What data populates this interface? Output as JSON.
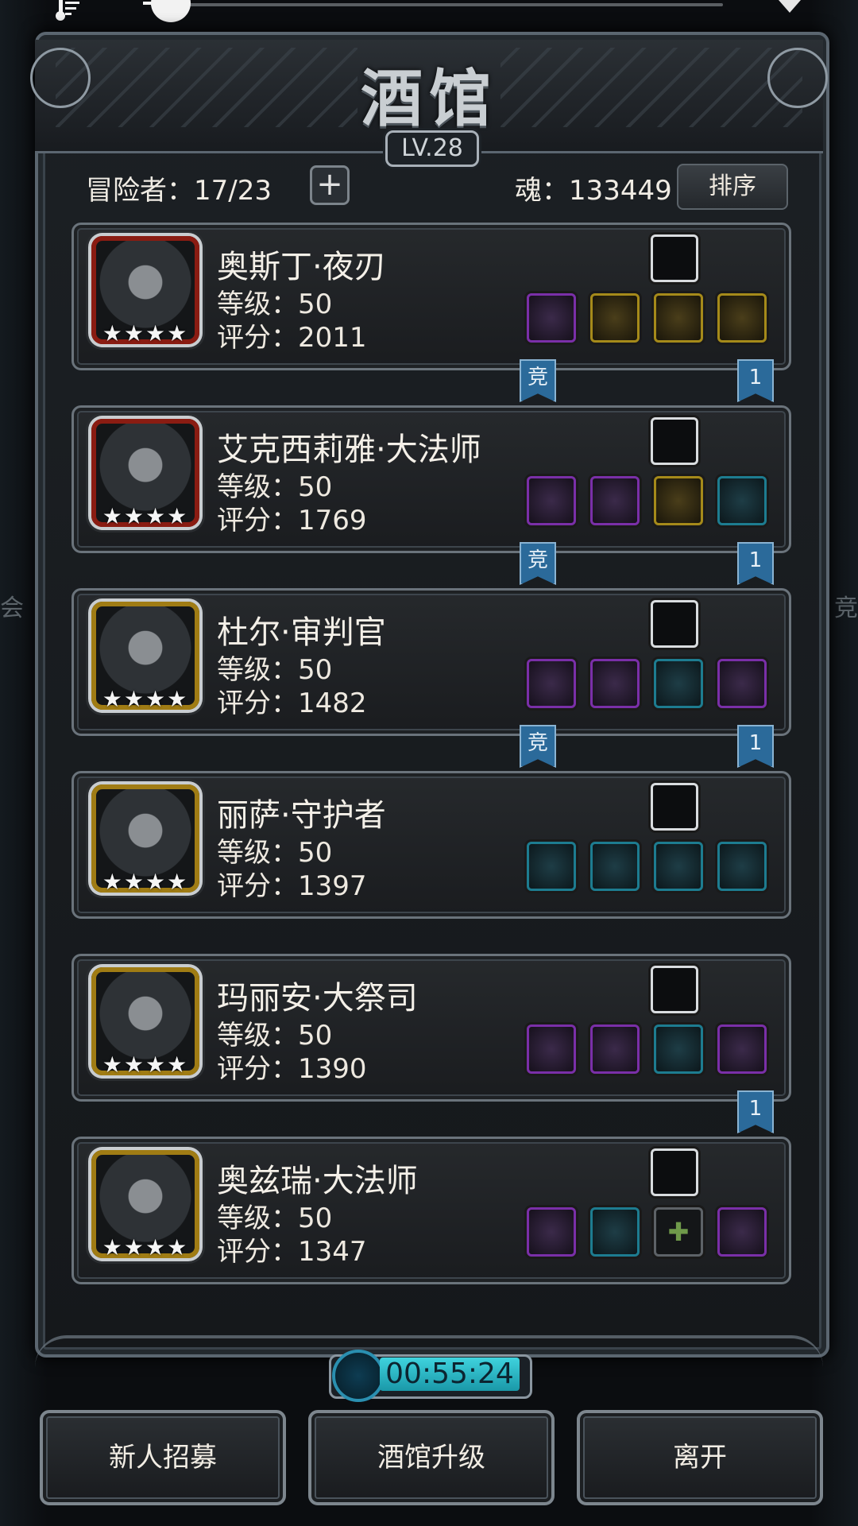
{
  "window": {
    "title": "酒馆",
    "level": "LV.28"
  },
  "stats": {
    "adventurers": "冒险者：17/23",
    "add_symbol": "+",
    "soul": "魂：133449",
    "sort_label": "排序"
  },
  "heroes": [
    {
      "name": "奥斯丁·夜刃",
      "level": "等级：50",
      "score": "评分：2011",
      "stars": "★★★★",
      "frame": "red",
      "slots": [
        "purple",
        "gold",
        "gold",
        "gold"
      ],
      "badge_left": "竞",
      "badge_right": "1"
    },
    {
      "name": "艾克西莉雅·大法师",
      "level": "等级：50",
      "score": "评分：1769",
      "stars": "★★★★",
      "frame": "red",
      "slots": [
        "purple",
        "purple",
        "gold",
        "teal"
      ],
      "badge_left": "竞",
      "badge_right": "1"
    },
    {
      "name": "杜尔·审判官",
      "level": "等级：50",
      "score": "评分：1482",
      "stars": "★★★★",
      "frame": "gold",
      "slots": [
        "purple",
        "purple",
        "teal",
        "purple"
      ],
      "badge_left": "竞",
      "badge_right": "1"
    },
    {
      "name": "丽萨·守护者",
      "level": "等级：50",
      "score": "评分：1397",
      "stars": "★★★★",
      "frame": "gold",
      "slots": [
        "teal",
        "teal",
        "teal",
        "teal"
      ],
      "badge_left": "",
      "badge_right": ""
    },
    {
      "name": "玛丽安·大祭司",
      "level": "等级：50",
      "score": "评分：1390",
      "stars": "★★★★",
      "frame": "gold",
      "slots": [
        "purple",
        "purple",
        "teal",
        "purple"
      ],
      "badge_left": "",
      "badge_right": "1"
    },
    {
      "name": "奥兹瑞·大法师",
      "level": "等级：50",
      "score": "评分：1347",
      "stars": "★★★★",
      "frame": "gold",
      "slots": [
        "purple",
        "teal",
        "empty",
        "purple"
      ],
      "badge_left": "",
      "badge_right": ""
    }
  ],
  "empty_slot_symbol": "✚",
  "timer": "00:55:24",
  "buttons": {
    "recruit": "新人招募",
    "upgrade": "酒馆升级",
    "leave": "离开"
  },
  "side_text": {
    "left": "会",
    "right": "竞"
  },
  "colors": {
    "accent_purple": "#7a2fa8",
    "accent_gold": "#a58a1a",
    "accent_teal": "#1d7c90",
    "ribbon_blue": "#2b6a9a",
    "timer_cyan": "#3fd3de"
  }
}
